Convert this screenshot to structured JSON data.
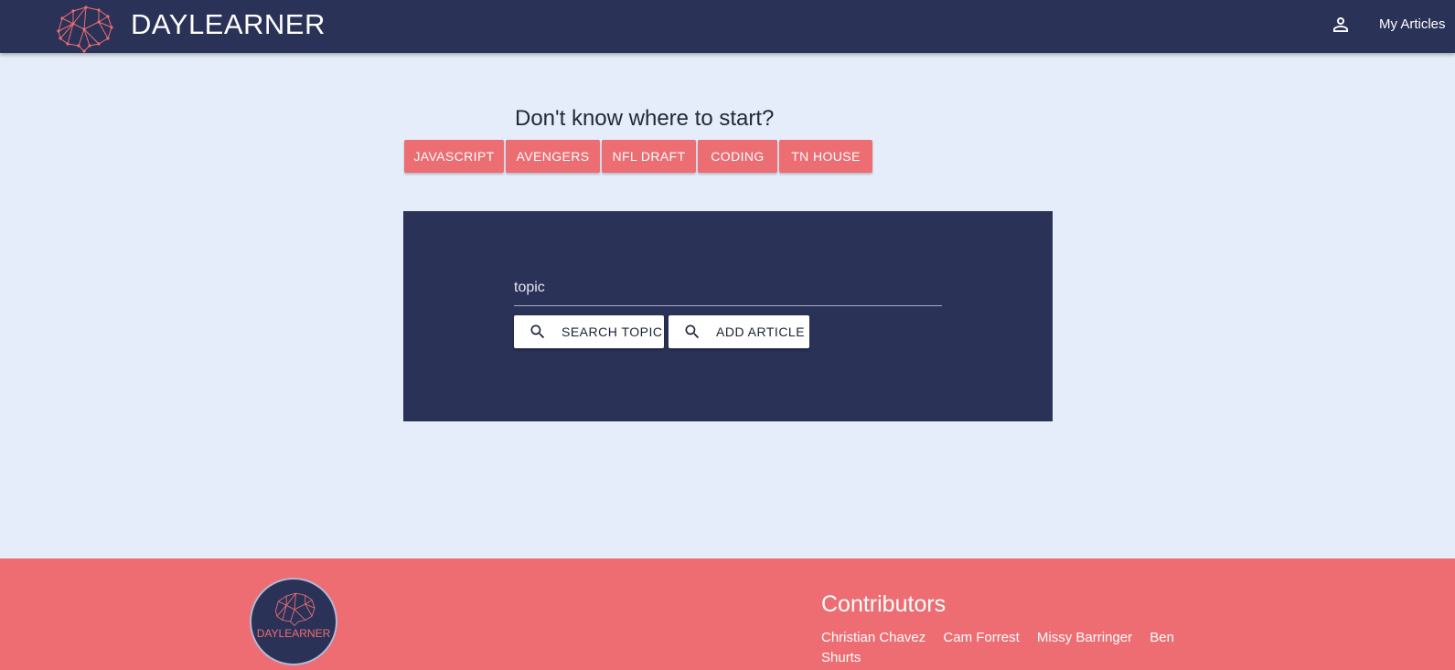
{
  "header": {
    "brand": "DAYLEARNER",
    "nav_link": "My Articles",
    "account_icon": "person-icon",
    "logo_icon": "brain-network-icon"
  },
  "suggestions": {
    "prompt": "Don't know where to start?",
    "topics": [
      "JAVASCRIPT",
      "AVENGERS",
      "NFL DRAFT",
      "CODING",
      "TN HOUSE"
    ]
  },
  "search": {
    "placeholder": "topic",
    "value": "",
    "search_button": "SEARCH TOPIC",
    "add_button": "ADD ARTICLE",
    "button_icon": "search-icon"
  },
  "footer": {
    "logo_text": "DAYLEARNER",
    "contributors_title": "Contributors",
    "contributors": [
      "Christian Chavez",
      "Cam Forrest",
      "Missy Barringer",
      "Ben Shurts"
    ]
  },
  "colors": {
    "navy": "#2b3258",
    "coral": "#ec6d72",
    "background": "#e4edf9"
  }
}
